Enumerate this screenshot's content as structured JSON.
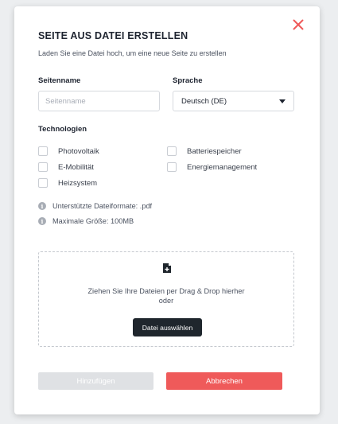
{
  "modal": {
    "title": "SEITE AUS DATEI ERSTELLEN",
    "subtitle": "Laden Sie eine Datei hoch, um eine neue Seite zu erstellen",
    "close_icon": "close-icon",
    "accent_color": "#ef5a5a"
  },
  "form": {
    "page_name_label": "Seitenname",
    "page_name_placeholder": "Seitenname",
    "page_name_value": "",
    "language_label": "Sprache",
    "language_value": "Deutsch (DE)",
    "technologies_label": "Technologien",
    "technologies": [
      {
        "label": "Photovoltaik",
        "checked": false
      },
      {
        "label": "Batteriespeicher",
        "checked": false
      },
      {
        "label": "E-Mobilität",
        "checked": false
      },
      {
        "label": "Energiemanagement",
        "checked": false
      },
      {
        "label": "Heizsystem",
        "checked": false
      }
    ]
  },
  "info": {
    "formats": "Unterstützte Dateiformate: .pdf",
    "max_size": "Maximale Größe: 100MB",
    "icon": "info-icon"
  },
  "dropzone": {
    "icon": "file-add-icon",
    "text": "Ziehen Sie Ihre Dateien per Drag & Drop hierher oder",
    "choose_button": "Datei auswählen"
  },
  "footer": {
    "add_button": "Hinzufügen",
    "cancel_button": "Abbrechen"
  }
}
